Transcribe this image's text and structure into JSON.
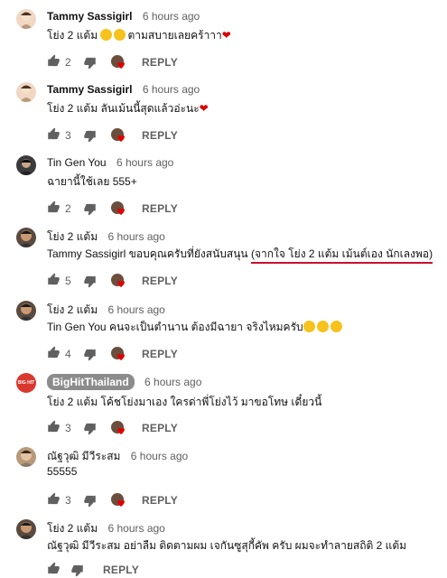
{
  "comments": [
    {
      "author": "Tammy Sassigirl",
      "time": "6 hours ago",
      "text": "โย่ง 2 แต้ม ",
      "text2": "ตามสบายเลยคร้าาา",
      "heart": "❤",
      "likes": "2",
      "reply": "REPLY",
      "avatar_color": "#f1d7c4"
    },
    {
      "author": "Tammy Sassigirl",
      "time": "6 hours ago",
      "text": "โย่ง 2 แต้ม ลันเม้นนี้สุดแล้วอ่ะนะ",
      "heart": "❤",
      "likes": "3",
      "reply": "REPLY",
      "avatar_color": "#f1d7c4"
    },
    {
      "author": "Tin Gen You",
      "time": "6 hours ago",
      "text": "ฉายานี้ใช้เลย 555+",
      "likes": "2",
      "reply": "REPLY",
      "avatar_color": "#3b3b3b"
    },
    {
      "author": "โย่ง 2 แต้ม",
      "time": "6 hours ago",
      "text": "Tammy Sassigirl ขอบคุณครับที่ยังสนับสนุน ",
      "text_ul": "(จากใจ โย่ง 2 แต้ม เม้นต์เอง นักเลงพอ)",
      "likes": "5",
      "reply": "REPLY",
      "avatar_color": "#5a4a3f"
    },
    {
      "author": "โย่ง 2 แต้ม",
      "time": "6 hours ago",
      "text": "Tin Gen You คนจะเป็นตำนาน ต้องมีฉายา จริงไหมครับ",
      "likes": "4",
      "reply": "REPLY",
      "avatar_color": "#5a4a3f"
    },
    {
      "author": "BigHitThailand",
      "time": "6 hours ago",
      "text": "โย่ง 2 แต้ม โค้ชโย่งมาเอง ใครด่าพี่โย่งไว้ มาขอโทษ เดี๋ยวนี้",
      "likes": "3",
      "reply": "REPLY",
      "avatar_color": "#d9382f",
      "avatar_text": "BIG HIT"
    },
    {
      "author": "ณัฐวุฒิ มีวีระสม",
      "time": "6 hours ago",
      "text": "55555",
      "likes": "3",
      "reply": "REPLY",
      "avatar_color": "#b89a7a"
    },
    {
      "author": "โย่ง 2 แต้ม",
      "time": "6 hours ago",
      "text": "ณัฐวุฒิ มีวีระสม อย่าลืม ติดตามผม เจกันซูสุกี้คัพ ครับ ผมจะทำลายสถิติ 2 แต้ม",
      "likes": "",
      "reply": "REPLY",
      "avatar_color": "#5a4a3f"
    }
  ]
}
